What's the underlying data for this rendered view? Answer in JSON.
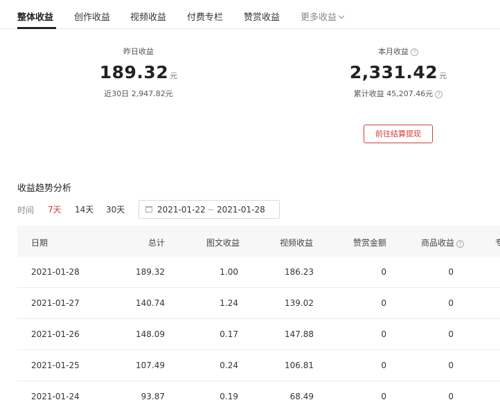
{
  "tabs": [
    {
      "label": "整体收益"
    },
    {
      "label": "创作收益"
    },
    {
      "label": "视频收益"
    },
    {
      "label": "付费专栏"
    },
    {
      "label": "赞赏收益"
    },
    {
      "label": "更多收益"
    }
  ],
  "summary": {
    "yesterday": {
      "label": "昨日收益",
      "value": "189.32",
      "unit": "元",
      "sub": "近30日 2,947.82元"
    },
    "month": {
      "label": "本月收益",
      "value": "2,331.42",
      "unit": "元",
      "sub": "累计收益 45,207.46元"
    },
    "settle_button": "前往结算提现"
  },
  "trend": {
    "title": "收益趋势分析",
    "range_label": "时间",
    "ranges": [
      "7天",
      "14天",
      "30天"
    ],
    "date_start": "2021-01-22",
    "date_sep": "~",
    "date_end": "2021-01-28"
  },
  "table": {
    "headers": [
      "日期",
      "总计",
      "图文收益",
      "视频收益",
      "赞赏金额",
      "商品收益",
      "专"
    ],
    "rows": [
      [
        "2021-01-28",
        "189.32",
        "1.00",
        "186.23",
        "0",
        "0"
      ],
      [
        "2021-01-27",
        "140.74",
        "1.24",
        "139.02",
        "0",
        "0"
      ],
      [
        "2021-01-26",
        "148.09",
        "0.17",
        "147.88",
        "0",
        "0"
      ],
      [
        "2021-01-25",
        "107.49",
        "0.24",
        "106.81",
        "0",
        "0"
      ],
      [
        "2021-01-24",
        "93.87",
        "0.19",
        "68.49",
        "0",
        "0"
      ]
    ]
  },
  "colors": {
    "accent": "#d43a3a",
    "header_bg": "#f7f7f7"
  }
}
